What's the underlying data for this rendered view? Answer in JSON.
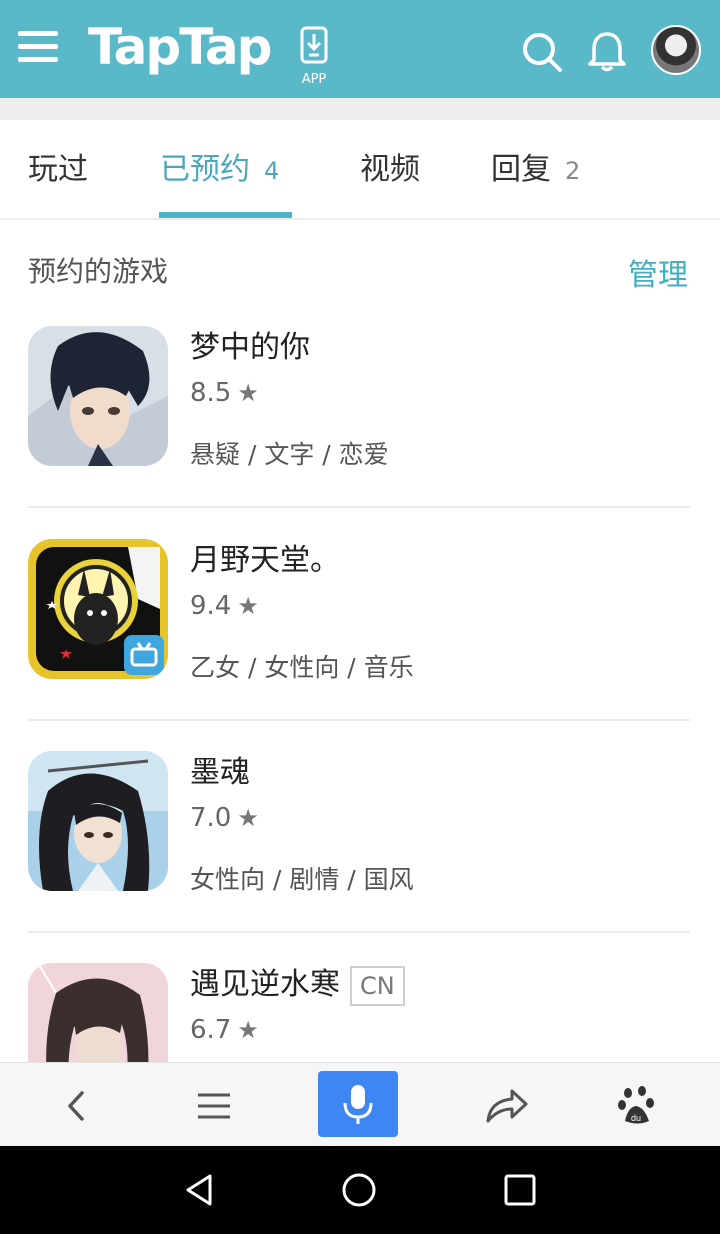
{
  "header": {
    "logo": "TapTap",
    "app_label": "APP",
    "colors": {
      "bar": "#5ab9c9",
      "accent": "#4aa7bd"
    },
    "icons": [
      "menu-icon",
      "download-app-icon",
      "search-icon",
      "bell-icon",
      "avatar"
    ]
  },
  "tabs": [
    {
      "label": "玩过",
      "count": ""
    },
    {
      "label": "已预约",
      "count": "4",
      "active": true
    },
    {
      "label": "视频",
      "count": ""
    },
    {
      "label": "回复",
      "count": "2"
    }
  ],
  "section": {
    "title": "预约的游戏",
    "manage": "管理"
  },
  "games": [
    {
      "name": "梦中的你",
      "rating": "8.5",
      "tags": "悬疑 / 文字 / 恋爱",
      "badge": ""
    },
    {
      "name": "月野天堂。",
      "rating": "9.4",
      "tags": "乙女 / 女性向 / 音乐",
      "badge": ""
    },
    {
      "name": "墨魂",
      "rating": "7.0",
      "tags": "女性向 / 剧情 / 国风",
      "badge": ""
    },
    {
      "name": "遇见逆水寒",
      "rating": "6.7",
      "tags": "",
      "badge": "CN"
    }
  ],
  "browser_bar": {
    "icons": [
      "back-icon",
      "menu-list-icon",
      "microphone-icon",
      "share-icon",
      "baidu-paw-icon"
    ]
  },
  "android_nav": {
    "icons": [
      "nav-back-icon",
      "nav-home-icon",
      "nav-recents-icon"
    ]
  }
}
